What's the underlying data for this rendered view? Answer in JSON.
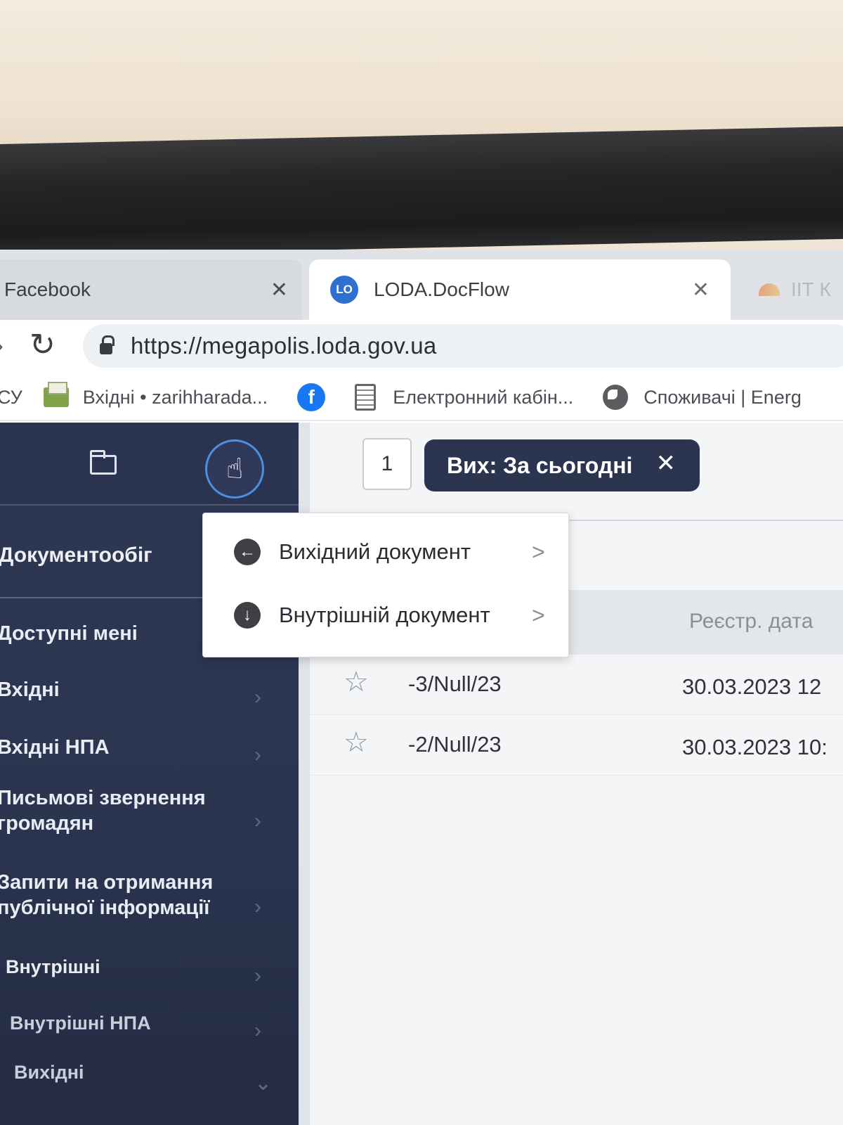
{
  "browser": {
    "tabs": [
      {
        "title": "Facebook",
        "close": "✕"
      },
      {
        "title": "LODA.DocFlow",
        "favicon": "LO",
        "close": "✕"
      },
      {
        "title": "ІІТ К"
      }
    ],
    "url": "https://megapolis.loda.gov.ua",
    "bookmarks": [
      {
        "label": "СУ"
      },
      {
        "label": "Вхідні • zarihharada...",
        "icon": "mail-icon"
      },
      {
        "label": "",
        "icon": "facebook-icon",
        "glyph": "f"
      },
      {
        "label": "Електронний кабін...",
        "icon": "document-icon"
      },
      {
        "label": "Споживачі | Energ",
        "icon": "globe-icon"
      }
    ]
  },
  "sidebar": {
    "actions_glyph": "☝",
    "collapse_glyph": "<",
    "section_title": "Документообіг",
    "items": [
      {
        "label": "Доступні мені"
      },
      {
        "label": "Вхідні"
      },
      {
        "label": "Вхідні НПА"
      },
      {
        "label": "Письмові звернення громадян"
      },
      {
        "label": "Запити на отримання публічної інформації"
      },
      {
        "label": "Внутрішні"
      },
      {
        "label": "Внутрішні НПА"
      },
      {
        "label": "Вихідні"
      }
    ]
  },
  "toolbar": {
    "page": "1",
    "filter_chip": "Вих: За сьогодні",
    "filter_close": "✕"
  },
  "dropdown": {
    "items": [
      {
        "label": "Вихідний документ",
        "icon": "arrow-left-circle-icon",
        "glyph": "←"
      },
      {
        "label": "Внутрішній документ",
        "icon": "arrow-down-circle-icon",
        "glyph": "↓"
      }
    ],
    "chevron": ">"
  },
  "table": {
    "columns": {
      "reg_date": "Реєстр. дата"
    },
    "rows": [
      {
        "number": "-3/Null/23",
        "reg_date": "30.03.2023 12"
      },
      {
        "number": "-2/Null/23",
        "reg_date": "30.03.2023 10:"
      }
    ],
    "star": "☆"
  },
  "colors": {
    "sidebar": "#2e3853",
    "chip": "#2c3550",
    "accent_ring": "#4a8fe0"
  }
}
